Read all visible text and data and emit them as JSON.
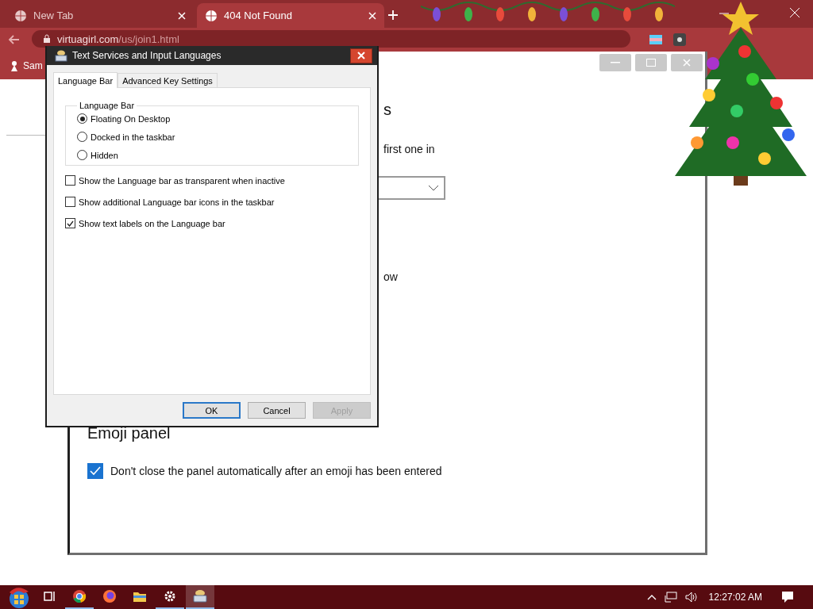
{
  "browser": {
    "tabs": [
      {
        "title": "New Tab",
        "selected": false
      },
      {
        "title": "404 Not Found",
        "selected": true
      }
    ],
    "address": "virtuagirl.com/us/join1.html",
    "bookmarks": [
      "Sam"
    ]
  },
  "settings_window": {
    "heading": "s",
    "lines": [
      "first one in",
      "ow"
    ],
    "emoji_heading": "Emoji panel",
    "emoji_option": {
      "label": "Don't close the panel automatically after an emoji has been entered",
      "checked": true
    }
  },
  "dialog": {
    "title": "Text Services and Input Languages",
    "tabs": [
      {
        "label": "Language Bar",
        "selected": true
      },
      {
        "label": "Advanced Key Settings",
        "selected": false
      }
    ],
    "group": "Language Bar",
    "radios": [
      {
        "label": "Floating On Desktop",
        "selected": true
      },
      {
        "label": "Docked in the taskbar",
        "selected": false
      },
      {
        "label": "Hidden",
        "selected": false
      }
    ],
    "checkboxes": [
      {
        "label": "Show the Language bar as transparent when inactive",
        "checked": false
      },
      {
        "label": "Show additional Language bar icons in the taskbar",
        "checked": false
      },
      {
        "label": "Show text labels on the Language bar",
        "checked": true
      }
    ],
    "buttons": [
      {
        "label": "OK",
        "disabled": false
      },
      {
        "label": "Cancel",
        "disabled": false
      },
      {
        "label": "Apply",
        "disabled": true
      }
    ]
  },
  "taskbar": {
    "apps": [
      {
        "kind": "taskview",
        "running": false
      },
      {
        "kind": "chrome",
        "running": true
      },
      {
        "kind": "firefox",
        "running": false
      },
      {
        "kind": "folder",
        "running": false
      },
      {
        "kind": "gear",
        "running": true
      },
      {
        "kind": "keyboard",
        "running": true
      }
    ],
    "clock": "12:27:02 AM"
  }
}
